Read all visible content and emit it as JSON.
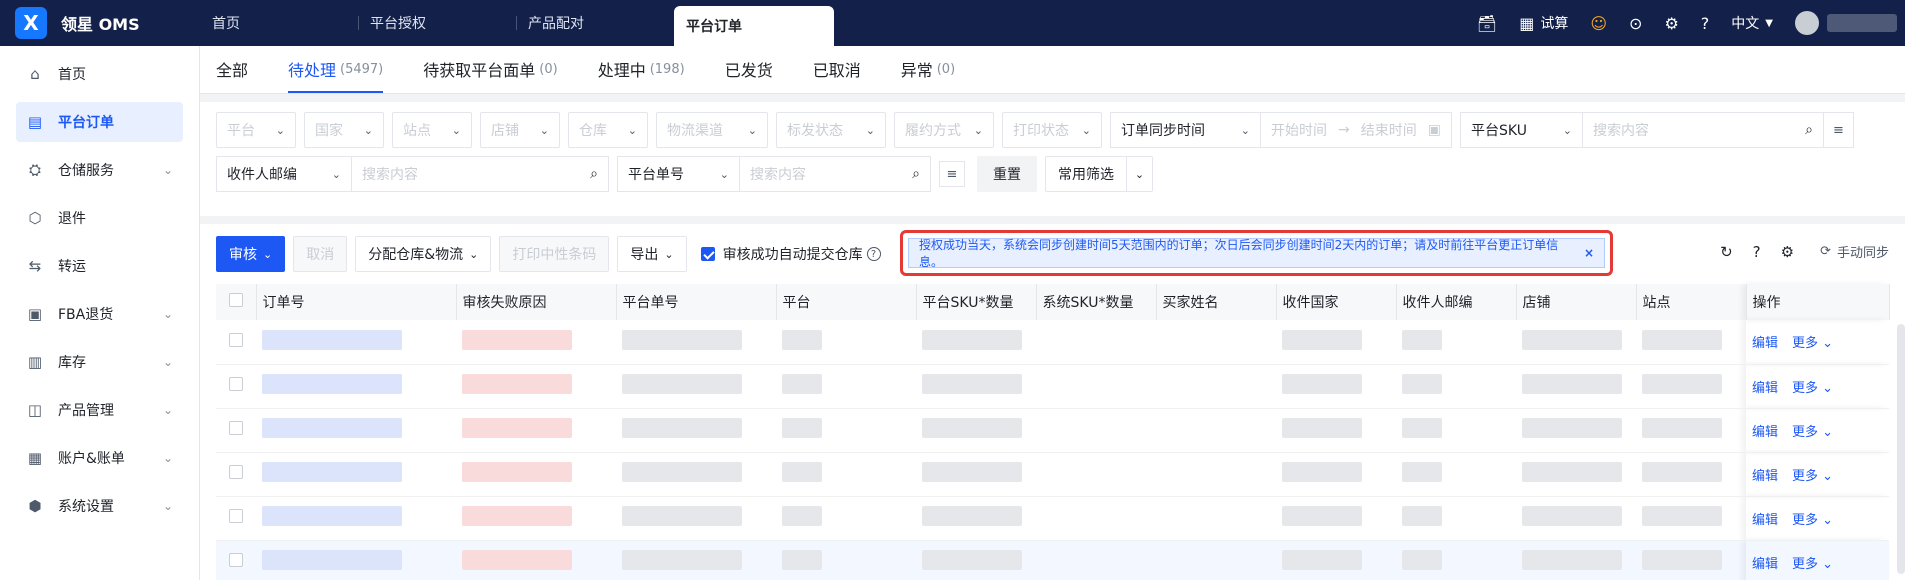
{
  "app": {
    "logo_glyph": "X",
    "name": "领星 OMS"
  },
  "top_tabs": [
    {
      "label": "首页"
    },
    {
      "label": "平台授权"
    },
    {
      "label": "产品配对"
    },
    {
      "label": "平台订单",
      "active": true
    }
  ],
  "top_right": {
    "trial_label": "试算",
    "lang_label": "中文"
  },
  "sidebar": {
    "items": [
      {
        "label": "首页",
        "icon": "home-icon"
      },
      {
        "label": "平台订单",
        "icon": "order-icon",
        "active": true
      },
      {
        "label": "仓储服务",
        "icon": "warehouse-icon",
        "expandable": true
      },
      {
        "label": "退件",
        "icon": "return-icon"
      },
      {
        "label": "转运",
        "icon": "transfer-icon"
      },
      {
        "label": "FBA退货",
        "icon": "fba-icon",
        "expandable": true
      },
      {
        "label": "库存",
        "icon": "inventory-icon",
        "expandable": true
      },
      {
        "label": "产品管理",
        "icon": "product-icon",
        "expandable": true
      },
      {
        "label": "账户&账单",
        "icon": "account-icon",
        "expandable": true
      },
      {
        "label": "系统设置",
        "icon": "settings-icon",
        "expandable": true
      }
    ]
  },
  "status_tabs": [
    {
      "label": "全部",
      "count": ""
    },
    {
      "label": "待处理",
      "count": "(5497)",
      "active": true
    },
    {
      "label": "待获取平台面单",
      "count": "(0)"
    },
    {
      "label": "处理中",
      "count": "(198)"
    },
    {
      "label": "已发货",
      "count": ""
    },
    {
      "label": "已取消",
      "count": ""
    },
    {
      "label": "异常",
      "count": "(0)"
    }
  ],
  "filters": {
    "row1": {
      "platform": "平台",
      "country": "国家",
      "site": "站点",
      "shop": "店铺",
      "warehouse": "仓库",
      "logistics": "物流渠道",
      "label_status": "标发状态",
      "fulfill_method": "履约方式",
      "print_status": "打印状态",
      "time_type": "订单同步时间",
      "start_time": "开始时间",
      "end_time": "结束时间",
      "sku_type": "平台SKU",
      "search_placeholder": "搜索内容"
    },
    "row2": {
      "postcode_type": "收件人邮编",
      "postcode_placeholder": "搜索内容",
      "order_no_type": "平台单号",
      "order_no_placeholder": "搜索内容",
      "reset": "重置",
      "common_filter": "常用筛选"
    }
  },
  "toolbar": {
    "audit": "审核",
    "cancel": "取消",
    "assign": "分配仓库&物流",
    "print_barcode": "打印中性条码",
    "export": "导出",
    "auto_submit": "审核成功自动提交仓库",
    "help_glyph": "?",
    "notice": "授权成功当天，系统会同步创建时间5天范围内的订单；次日后会同步创建时间2天内的订单；请及时前往平台更正订单信息。",
    "notice_close": "×",
    "manual_sync": "手动同步"
  },
  "table": {
    "headers": [
      "订单号",
      "审核失败原因",
      "平台单号",
      "平台",
      "平台SKU*数量",
      "系统SKU*数量",
      "买家姓名",
      "收件国家",
      "收件人邮编",
      "店铺",
      "站点",
      "操作"
    ],
    "row_action_edit": "编辑",
    "row_action_more": "更多",
    "row_count": 6
  },
  "colors": {
    "topbar": "#13214a",
    "accent": "#1d58f5",
    "highlight_border": "#e53935"
  }
}
